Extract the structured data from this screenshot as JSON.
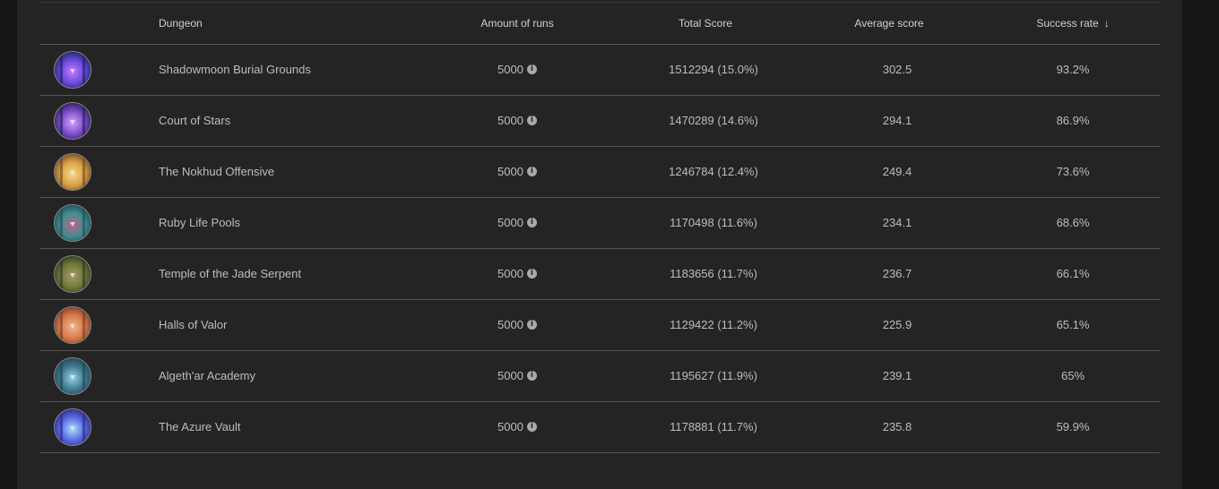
{
  "table": {
    "headers": {
      "dungeon": "Dungeon",
      "runs": "Amount of runs",
      "total": "Total Score",
      "average": "Average score",
      "success": "Success rate"
    },
    "sort": {
      "column": "success",
      "direction": "descending",
      "icon": "arrow-down-icon"
    },
    "rows": [
      {
        "dungeon": "Shadowmoon Burial Grounds",
        "runs": "5000",
        "total": "1512294 (15.0%)",
        "average": "302.5",
        "success": "93.2%",
        "colors": [
          "#1d1e6b",
          "#6a4bd6",
          "#c07cff"
        ]
      },
      {
        "dungeon": "Court of Stars",
        "runs": "5000",
        "total": "1470289 (14.6%)",
        "average": "294.1",
        "success": "86.9%",
        "colors": [
          "#281a57",
          "#7a4fc9",
          "#d9a0ff"
        ]
      },
      {
        "dungeon": "The Nokhud Offensive",
        "runs": "5000",
        "total": "1246784 (12.4%)",
        "average": "249.4",
        "success": "73.6%",
        "colors": [
          "#6b4a1c",
          "#d9a248",
          "#f4d98a"
        ]
      },
      {
        "dungeon": "Ruby Life Pools",
        "runs": "5000",
        "total": "1170498 (11.6%)",
        "average": "234.1",
        "success": "68.6%",
        "colors": [
          "#1f4b55",
          "#3f8f8f",
          "#c85e8c"
        ]
      },
      {
        "dungeon": "Temple of the Jade Serpent",
        "runs": "5000",
        "total": "1183656 (11.7%)",
        "average": "236.7",
        "success": "66.1%",
        "colors": [
          "#2c3a1c",
          "#6f7a3a",
          "#a99a6a"
        ]
      },
      {
        "dungeon": "Halls of Valor",
        "runs": "5000",
        "total": "1129422 (11.2%)",
        "average": "225.9",
        "success": "65.1%",
        "colors": [
          "#7a3a22",
          "#d97b4f",
          "#f2b48a"
        ]
      },
      {
        "dungeon": "Algeth'ar Academy",
        "runs": "5000",
        "total": "1195627 (11.9%)",
        "average": "239.1",
        "success": "65%",
        "colors": [
          "#1f4457",
          "#3f7a8f",
          "#9bd3e6"
        ]
      },
      {
        "dungeon": "The Azure Vault",
        "runs": "5000",
        "total": "1178881 (11.7%)",
        "average": "235.8",
        "success": "59.9%",
        "colors": [
          "#2a2a8a",
          "#5a6ae0",
          "#aee0ff"
        ]
      }
    ],
    "info_icon": "info-icon"
  }
}
